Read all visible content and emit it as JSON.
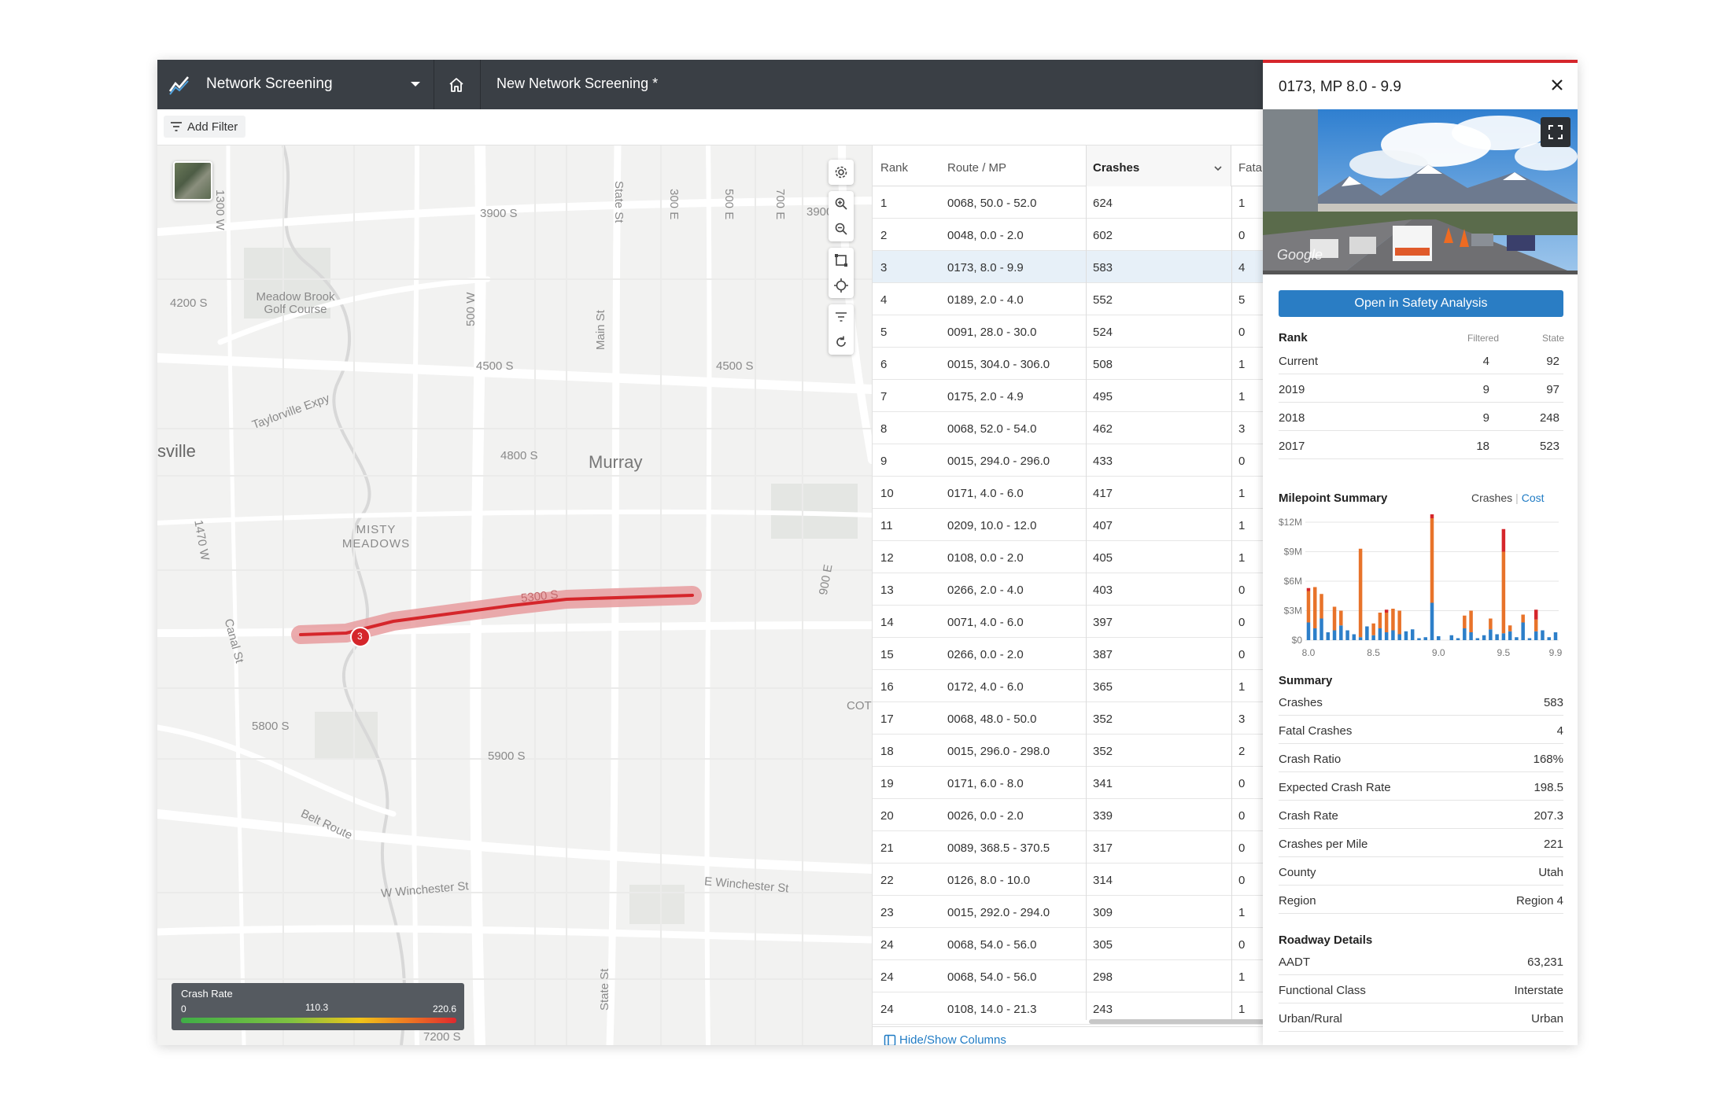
{
  "header": {
    "app_title": "Network Screening",
    "screening_name": "New Network Screening *"
  },
  "filterbar": {
    "add_filter_label": "Add Filter"
  },
  "map": {
    "labels": {
      "l1300w": "1300 W",
      "s3900a": "3900 S",
      "s3900b": "3900",
      "statest1": "State St",
      "e300": "300 E",
      "e500": "500 E",
      "e700": "700 E",
      "s4200": "4200 S",
      "meadowbrook": "Meadow Brook Golf Course",
      "w500": "500 W",
      "mainst": "Main St",
      "s4500a": "4500 S",
      "s4500b": "4500 S",
      "taylorsville": "Taylorville Expy",
      "sville": "sville",
      "s4800": "4800 S",
      "murray": "Murray",
      "w1470": "1470 W",
      "misty": "MISTY MEADOWS",
      "e900": "900 E",
      "s5300": "5300 S",
      "canalst": "Canal St",
      "s5800": "5800 S",
      "s5900": "5900 S",
      "cot": "COT",
      "beltroute": "Belt Route",
      "wwinchester": "W Winchester St",
      "ewinchester": "E Winchester St",
      "statest2": "State St",
      "s7200": "7200 S"
    },
    "marker_label": "3",
    "legend": {
      "title": "Crash Rate",
      "min": "0",
      "mid": "110.3",
      "max": "220.6"
    }
  },
  "table": {
    "headers": {
      "rank": "Rank",
      "route": "Route / MP",
      "crashes": "Crashes",
      "fatal": "Fatalit"
    },
    "rows": [
      {
        "rank": "1",
        "route": "0068, 50.0 - 52.0",
        "crashes": "624",
        "fatal": "1"
      },
      {
        "rank": "2",
        "route": "0048, 0.0 - 2.0",
        "crashes": "602",
        "fatal": "0"
      },
      {
        "rank": "3",
        "route": "0173, 8.0 - 9.9",
        "crashes": "583",
        "fatal": "4"
      },
      {
        "rank": "4",
        "route": "0189, 2.0 - 4.0",
        "crashes": "552",
        "fatal": "5"
      },
      {
        "rank": "5",
        "route": "0091, 28.0 - 30.0",
        "crashes": "524",
        "fatal": "0"
      },
      {
        "rank": "6",
        "route": "0015, 304.0 - 306.0",
        "crashes": "508",
        "fatal": "1"
      },
      {
        "rank": "7",
        "route": "0175, 2.0 - 4.9",
        "crashes": "495",
        "fatal": "1"
      },
      {
        "rank": "8",
        "route": "0068, 52.0 - 54.0",
        "crashes": "462",
        "fatal": "3"
      },
      {
        "rank": "9",
        "route": "0015, 294.0 - 296.0",
        "crashes": "433",
        "fatal": "0"
      },
      {
        "rank": "10",
        "route": "0171, 4.0 - 6.0",
        "crashes": "417",
        "fatal": "1"
      },
      {
        "rank": "11",
        "route": "0209, 10.0 - 12.0",
        "crashes": "407",
        "fatal": "1"
      },
      {
        "rank": "12",
        "route": "0108, 0.0 - 2.0",
        "crashes": "405",
        "fatal": "1"
      },
      {
        "rank": "13",
        "route": "0266, 2.0 - 4.0",
        "crashes": "403",
        "fatal": "0"
      },
      {
        "rank": "14",
        "route": "0071, 4.0 - 6.0",
        "crashes": "397",
        "fatal": "0"
      },
      {
        "rank": "15",
        "route": "0266, 0.0 - 2.0",
        "crashes": "387",
        "fatal": "0"
      },
      {
        "rank": "16",
        "route": "0172, 4.0 - 6.0",
        "crashes": "365",
        "fatal": "1"
      },
      {
        "rank": "17",
        "route": "0068, 48.0 - 50.0",
        "crashes": "352",
        "fatal": "3"
      },
      {
        "rank": "18",
        "route": "0015, 296.0 - 298.0",
        "crashes": "352",
        "fatal": "2"
      },
      {
        "rank": "19",
        "route": "0171, 6.0 - 8.0",
        "crashes": "341",
        "fatal": "0"
      },
      {
        "rank": "20",
        "route": "0026, 0.0 - 2.0",
        "crashes": "339",
        "fatal": "0"
      },
      {
        "rank": "21",
        "route": "0089, 368.5 - 370.5",
        "crashes": "317",
        "fatal": "0"
      },
      {
        "rank": "22",
        "route": "0126, 8.0 - 10.0",
        "crashes": "314",
        "fatal": "0"
      },
      {
        "rank": "23",
        "route": "0015, 292.0 - 294.0",
        "crashes": "309",
        "fatal": "1"
      },
      {
        "rank": "24",
        "route": "0068, 54.0 - 56.0",
        "crashes": "305",
        "fatal": "0"
      },
      {
        "rank": "24",
        "route": "0068, 54.0 - 56.0",
        "crashes": "298",
        "fatal": "1"
      },
      {
        "rank": "24",
        "route": "0108, 14.0 - 21.3",
        "crashes": "243",
        "fatal": "1"
      }
    ],
    "selected_rank": "3",
    "hide_show_label": "Hide/Show Columns"
  },
  "panel": {
    "title": "0173, MP 8.0 - 9.9",
    "photo_watermark": "Google",
    "open_button": "Open in Safety Analysis",
    "rank": {
      "title": "Rank",
      "col_filtered": "Filtered",
      "col_state": "State",
      "rows": [
        {
          "label": "Current",
          "filtered": "4",
          "state": "92"
        },
        {
          "label": "2019",
          "filtered": "9",
          "state": "97"
        },
        {
          "label": "2018",
          "filtered": "9",
          "state": "248"
        },
        {
          "label": "2017",
          "filtered": "18",
          "state": "523"
        }
      ]
    },
    "milepoint": {
      "title": "Milepoint Summary",
      "toggle_crashes": "Crashes",
      "toggle_cost": "Cost",
      "active": "Cost"
    },
    "summary": {
      "title": "Summary",
      "rows": [
        {
          "label": "Crashes",
          "value": "583"
        },
        {
          "label": "Fatal Crashes",
          "value": "4"
        },
        {
          "label": "Crash Ratio",
          "value": "168%"
        },
        {
          "label": "Expected Crash Rate",
          "value": "198.5"
        },
        {
          "label": "Crash Rate",
          "value": "207.3"
        },
        {
          "label": "Crashes per Mile",
          "value": "221"
        },
        {
          "label": "County",
          "value": "Utah"
        },
        {
          "label": "Region",
          "value": "Region 4"
        }
      ]
    },
    "roadway": {
      "title": "Roadway Details",
      "rows": [
        {
          "label": "AADT",
          "value": "63,231"
        },
        {
          "label": "Functional Class",
          "value": "Interstate"
        },
        {
          "label": "Urban/Rural",
          "value": "Urban"
        }
      ]
    }
  },
  "colors": {
    "header_bg": "#3a3f45",
    "accent_blue": "#2a7dc4",
    "accent_red": "#d5262b",
    "bar_blue": "#2d7fc9",
    "bar_orange": "#e8732a",
    "bar_red": "#d5262b"
  },
  "chart_data": {
    "type": "bar",
    "title": "Milepoint Summary",
    "y_ticks": [
      "$0",
      "$3M",
      "$6M",
      "$9M",
      "$12M"
    ],
    "x_ticks": [
      "8.0",
      "8.5",
      "9.0",
      "9.5",
      "9.9"
    ],
    "ylim": [
      0,
      12
    ],
    "x": [
      8.0,
      8.05,
      8.1,
      8.15,
      8.2,
      8.25,
      8.3,
      8.35,
      8.4,
      8.45,
      8.5,
      8.55,
      8.6,
      8.65,
      8.7,
      8.75,
      8.8,
      8.85,
      8.9,
      8.95,
      9.0,
      9.05,
      9.1,
      9.15,
      9.2,
      9.25,
      9.3,
      9.35,
      9.4,
      9.45,
      9.5,
      9.55,
      9.6,
      9.65,
      9.7,
      9.75,
      9.8,
      9.85,
      9.9
    ],
    "series": [
      {
        "name": "blue",
        "values": [
          1.8,
          1.2,
          2.2,
          0.8,
          1.0,
          1.5,
          1.0,
          0.6,
          0.3,
          1.4,
          0.5,
          1.2,
          0.8,
          1.0,
          0.6,
          0.9,
          1.1,
          0.2,
          0.3,
          3.8,
          0.4,
          0.0,
          0.5,
          0.2,
          1.2,
          0.8,
          0.2,
          0.5,
          1.1,
          0.6,
          0.7,
          0.9,
          0.3,
          1.8,
          0.2,
          0.9,
          1.0,
          0.3,
          0.8
        ]
      },
      {
        "name": "orange",
        "values": [
          3.2,
          4.2,
          2.5,
          0.0,
          2.4,
          1.5,
          0.0,
          0.0,
          9.0,
          0.0,
          1.2,
          1.6,
          2.0,
          2.2,
          2.4,
          0.0,
          0.0,
          0.0,
          0.0,
          8.6,
          0.0,
          0.0,
          0.0,
          0.0,
          1.3,
          2.2,
          0.0,
          0.0,
          1.1,
          0.0,
          8.3,
          0.6,
          0.0,
          0.8,
          0.0,
          1.2,
          0.0,
          0.0,
          0.0
        ]
      },
      {
        "name": "red",
        "values": [
          0.3,
          0.0,
          0.0,
          0.0,
          0.0,
          0.0,
          0.0,
          0.0,
          0.0,
          0.0,
          0.0,
          0.0,
          0.3,
          0.0,
          0.0,
          0.0,
          0.0,
          0.0,
          0.0,
          0.9,
          0.0,
          0.0,
          0.0,
          0.0,
          0.0,
          0.0,
          0.0,
          0.0,
          0.0,
          0.0,
          2.3,
          0.0,
          0.0,
          0.0,
          0.0,
          1.0,
          0.0,
          0.0,
          0.0
        ]
      }
    ]
  }
}
